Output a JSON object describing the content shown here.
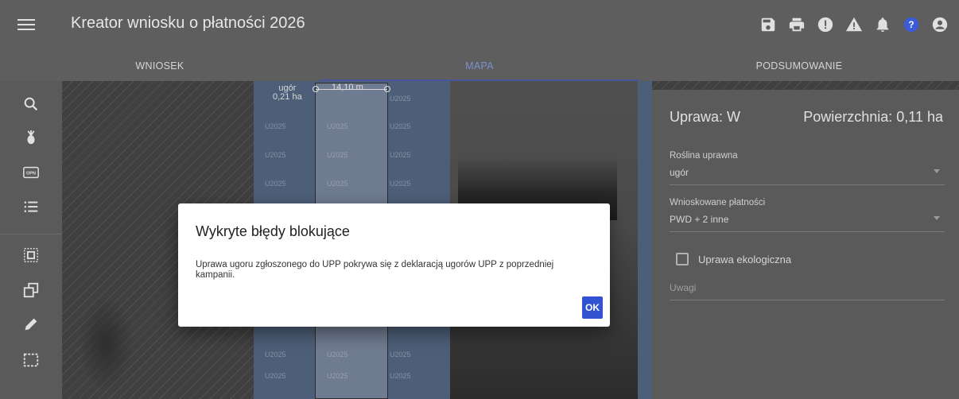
{
  "app": {
    "title": "Kreator wniosku o płatności 2026",
    "actions": [
      "save-icon",
      "print-icon",
      "error-icon",
      "warning-icon",
      "bell-icon",
      "help-icon",
      "account-icon"
    ],
    "accent_color": "#3f51b5",
    "help_color": "#3b5bdb"
  },
  "tabs": [
    {
      "label": "WNIOSEK",
      "active": false
    },
    {
      "label": "MAPA",
      "active": true
    },
    {
      "label": "PODSUMOWANIE",
      "active": false
    }
  ],
  "tools": [
    "search-icon",
    "plant-icon",
    "opn-icon",
    "list-icon",
    "select-parcel-icon",
    "copy-icon",
    "edit-pencil-icon",
    "select-area-icon"
  ],
  "tool_opn_text": "OPN",
  "map": {
    "parcel_label": "ugór",
    "parcel_area": "0,21 ha",
    "measure_text": "14,10 m",
    "plot_code": "U2025"
  },
  "panel": {
    "title": "Uprawa: W",
    "area": "Powierzchnia: 0,11 ha",
    "crop_label": "Roślina uprawna",
    "crop_value": "ugór",
    "payments_label": "Wnioskowane płatności",
    "payments_value": "PWD + 2 inne",
    "organic_label": "Uprawa ekologiczna",
    "notes_placeholder": "Uwagi"
  },
  "dialog": {
    "title": "Wykryte błędy blokujące",
    "message": "Uprawa ugoru zgłoszonego do UPP pokrywa się z deklaracją ugorów UPP z poprzedniej kampanii.",
    "ok_label": "OK",
    "ok_color": "#3352d2"
  }
}
